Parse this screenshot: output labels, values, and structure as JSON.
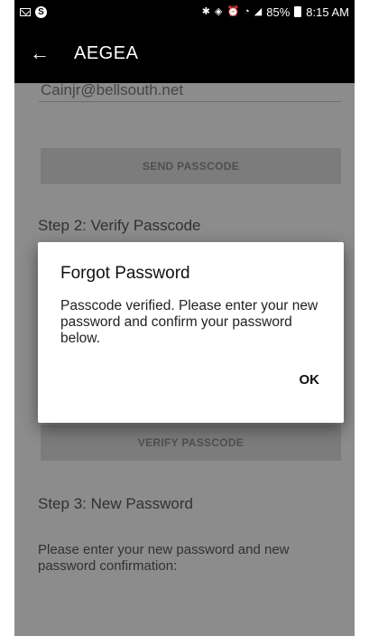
{
  "status_bar": {
    "battery": "85%",
    "time": "8:15 AM"
  },
  "app_bar": {
    "back_glyph": "←",
    "title": "AEGEA"
  },
  "form": {
    "email_value": "Cainjr@bellsouth.net",
    "send_passcode_label": "SEND PASSCODE",
    "step2_heading": "Step 2: Verify Passcode",
    "verify_passcode_label": "VERIFY PASSCODE",
    "step3_heading": "Step 3: New Password",
    "step3_description": "Please enter your new password and new password confirmation:"
  },
  "dialog": {
    "title": "Forgot Password",
    "message": "Passcode verified. Please enter your new password and confirm your password below.",
    "ok_label": "OK"
  }
}
